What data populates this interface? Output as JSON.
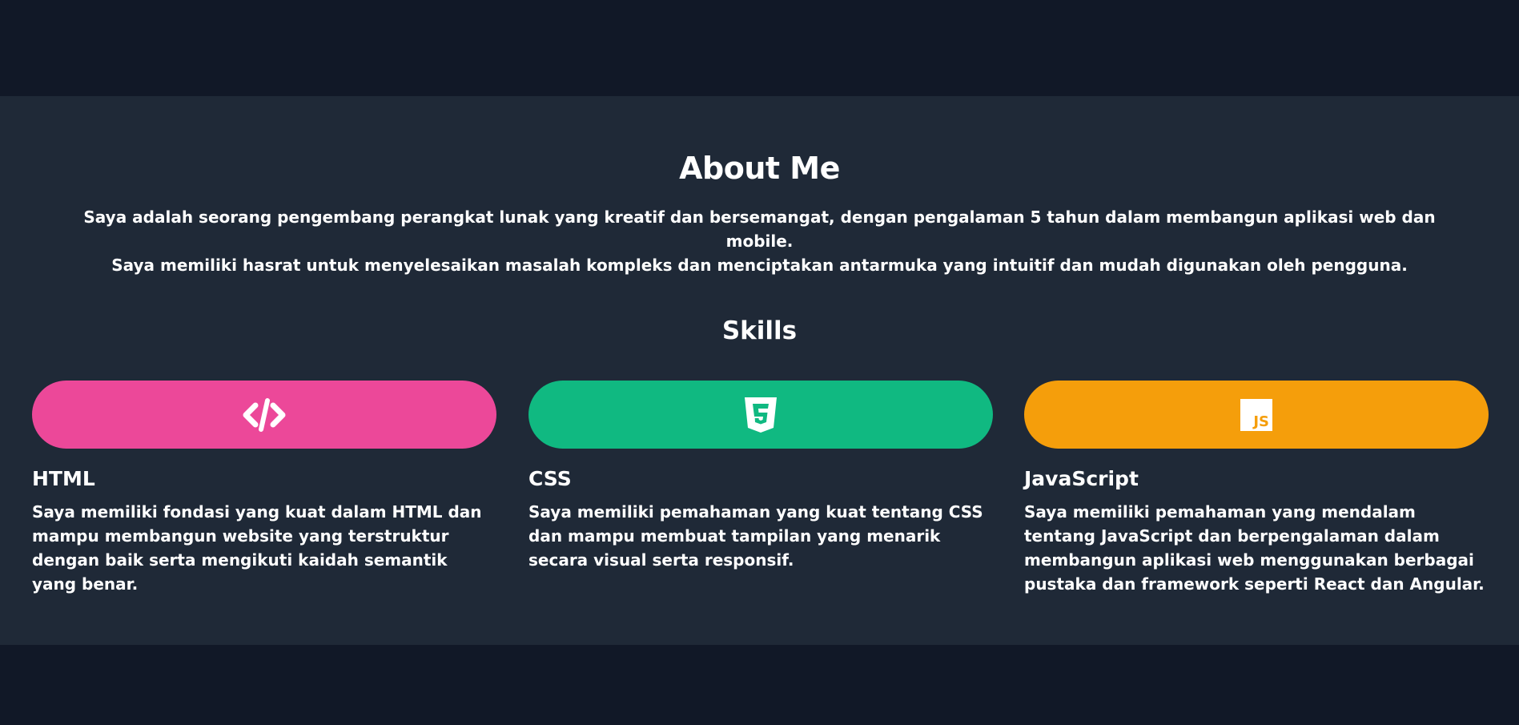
{
  "about": {
    "title": "About Me",
    "line1": "Saya adalah seorang pengembang perangkat lunak yang kreatif dan bersemangat, dengan pengalaman 5 tahun dalam membangun aplikasi web dan mobile.",
    "line2": "Saya memiliki hasrat untuk menyelesaikan masalah kompleks dan menciptakan antarmuka yang intuitif dan mudah digunakan oleh pengguna."
  },
  "skills": {
    "title": "Skills",
    "items": [
      {
        "name": "HTML",
        "icon": "code-icon",
        "color": "#ec4899",
        "description": "Saya memiliki fondasi yang kuat dalam HTML dan mampu membangun website yang terstruktur dengan baik serta mengikuti kaidah semantik yang benar."
      },
      {
        "name": "CSS",
        "icon": "css3-icon",
        "color": "#10b981",
        "description": "Saya memiliki pemahaman yang kuat tentang CSS dan mampu membuat tampilan yang menarik secara visual serta responsif."
      },
      {
        "name": "JavaScript",
        "icon": "js-icon",
        "icon_text": "JS",
        "color": "#f59e0b",
        "description": "Saya memiliki pemahaman yang mendalam tentang JavaScript dan berpengalaman dalam membangun aplikasi web menggunakan berbagai pustaka dan framework seperti React dan Angular."
      }
    ]
  },
  "colors": {
    "page_background": "#111827",
    "section_background": "#1f2937",
    "text": "#ffffff"
  }
}
